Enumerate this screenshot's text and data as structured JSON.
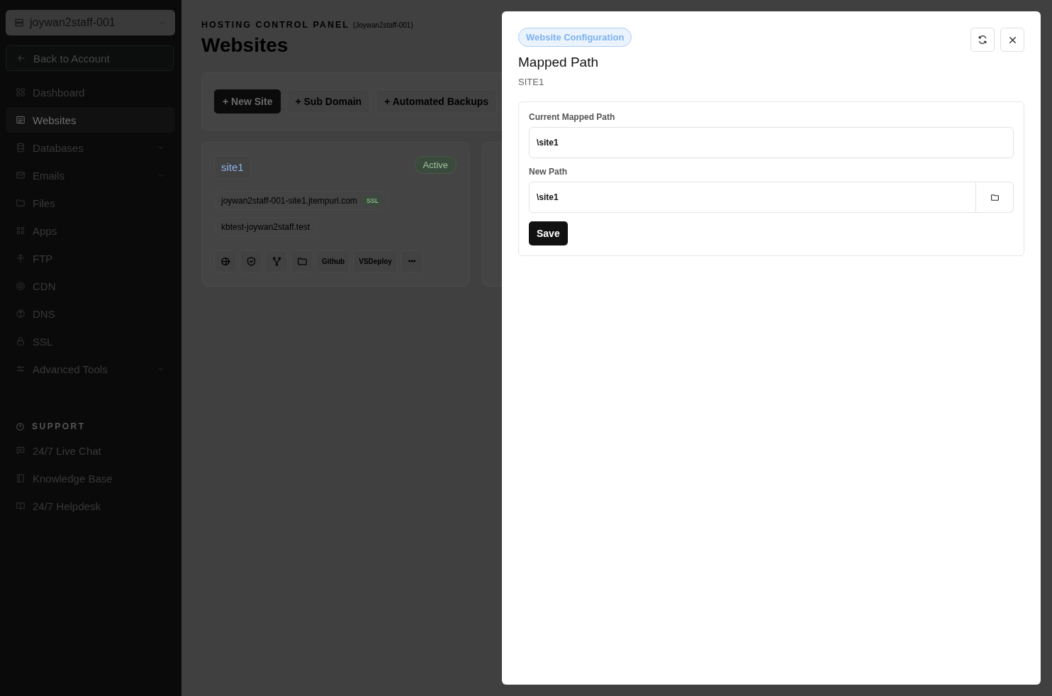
{
  "sidebar": {
    "account_selector": "joywan2staff-001",
    "back_link": "Back to Account",
    "nav": [
      {
        "label": "Dashboard",
        "selected": false,
        "expandable": false
      },
      {
        "label": "Websites",
        "selected": true,
        "expandable": false
      },
      {
        "label": "Databases",
        "selected": false,
        "expandable": true
      },
      {
        "label": "Emails",
        "selected": false,
        "expandable": true
      },
      {
        "label": "Files",
        "selected": false,
        "expandable": false
      },
      {
        "label": "Apps",
        "selected": false,
        "expandable": false
      },
      {
        "label": "FTP",
        "selected": false,
        "expandable": false
      },
      {
        "label": "CDN",
        "selected": false,
        "expandable": false
      },
      {
        "label": "DNS",
        "selected": false,
        "expandable": false
      },
      {
        "label": "SSL",
        "selected": false,
        "expandable": false
      },
      {
        "label": "Advanced Tools",
        "selected": false,
        "expandable": true
      }
    ],
    "support": {
      "heading": "SUPPORT",
      "items": [
        {
          "label": "24/7 Live Chat"
        },
        {
          "label": "Knowledge Base"
        },
        {
          "label": "24/7 Helpdesk"
        }
      ]
    }
  },
  "header": {
    "eyebrow": "HOSTING CONTROL PANEL",
    "account": "(Joywan2staff-001)",
    "title": "Websites"
  },
  "toolbar": [
    {
      "label": "+ New Site",
      "kind": "primary"
    },
    {
      "label": "+ Sub Domain",
      "kind": "outline"
    },
    {
      "label": "+ Automated Backups",
      "kind": "outline"
    }
  ],
  "sites": [
    {
      "name": "site1",
      "status": "Active",
      "domains": [
        {
          "host": "joywan2staff-001-site1.jtempurl.com",
          "ssl": "SSL"
        },
        {
          "host": "kbtest-joywan2staff.test"
        }
      ],
      "actions": [
        {
          "kind": "icon"
        },
        {
          "kind": "icon"
        },
        {
          "kind": "icon"
        },
        {
          "kind": "icon"
        },
        {
          "kind": "text",
          "label": "Github"
        },
        {
          "kind": "text",
          "label": "VSDeploy"
        },
        {
          "kind": "icon"
        }
      ]
    },
    {
      "kind": "hidden"
    }
  ],
  "modal": {
    "badge": "Website Configuration",
    "title": "Mapped Path",
    "subtitle": "SITE1",
    "fields": [
      {
        "label": "Current Mapped Path",
        "value": "\\site1",
        "kind": "text"
      },
      {
        "label": "New Path",
        "value": "\\site1",
        "kind": "browse"
      }
    ],
    "submit": "Save"
  }
}
